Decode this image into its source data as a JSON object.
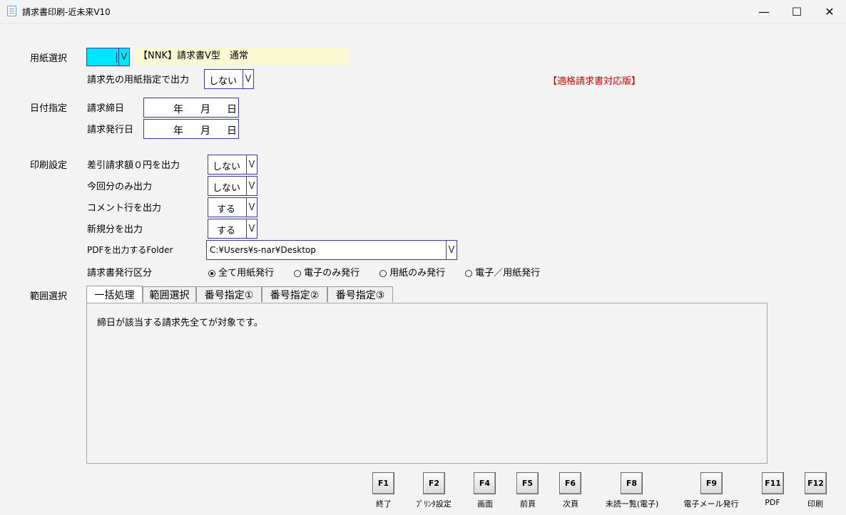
{
  "window": {
    "title": "請求書印刷-近未来V10",
    "minimize": "—",
    "maximize": "☐",
    "close": "✕"
  },
  "paper": {
    "section_label": "用紙選択",
    "selected_text": "【NNK】請求書Ⅴ型　通常",
    "selected_color": "#00e5ff",
    "dest_label": "請求先の用紙指定で出力",
    "dest_value": "しない",
    "notice": "【適格請求書対応版】",
    "notice_color": "#cc0000"
  },
  "date": {
    "section_label": "日付指定",
    "close_label": "請求締日",
    "issue_label": "請求発行日",
    "year": "年",
    "month": "月",
    "day": "日"
  },
  "print": {
    "section_label": "印刷設定",
    "rows": [
      {
        "label": "差引請求額０円を出力",
        "value": "しない"
      },
      {
        "label": "今回分のみ出力",
        "value": "しない"
      },
      {
        "label": "コメント行を出力",
        "value": "する"
      },
      {
        "label": "新規分を出力",
        "value": "する"
      }
    ],
    "pdf_label": "PDFを出力するFolder",
    "pdf_path": "C:¥Users¥s-nar¥Desktop",
    "issue_type_label": "請求書発行区分",
    "issue_types": [
      "全て用紙発行",
      "電子のみ発行",
      "用紙のみ発行",
      "電子／用紙発行"
    ],
    "issue_selected": "全て用紙発行"
  },
  "range": {
    "section_label": "範囲選択",
    "tabs": [
      "一括処理",
      "範囲選択",
      "番号指定①",
      "番号指定②",
      "番号指定③"
    ],
    "active_tab": "一括処理",
    "message": "締日が該当する請求先全てが対象です。"
  },
  "arrow_glyph": "V",
  "fkeys": [
    {
      "key": "F1",
      "caption": "終了"
    },
    {
      "key": "F2",
      "caption": "ﾌﾟﾘﾝﾀ設定"
    },
    {
      "key": "F4",
      "caption": "画面"
    },
    {
      "key": "F5",
      "caption": "前頁"
    },
    {
      "key": "F6",
      "caption": "次頁"
    },
    {
      "key": "F8",
      "caption": "未読一覧(電子)"
    },
    {
      "key": "F9",
      "caption": "電子メール発行"
    },
    {
      "key": "F11",
      "caption": "PDF"
    },
    {
      "key": "F12",
      "caption": "印刷"
    }
  ]
}
